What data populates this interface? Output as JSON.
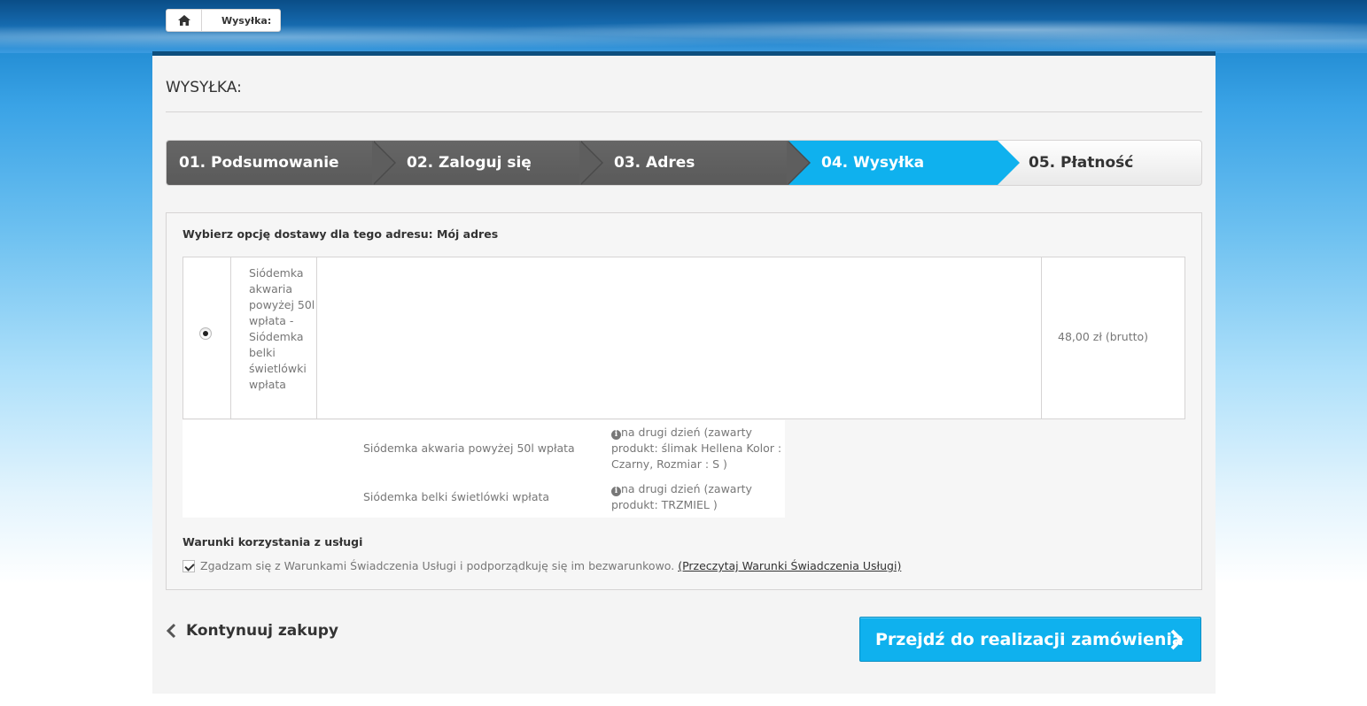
{
  "breadcrumb": {
    "home_icon": "home-icon",
    "current": "Wysyłka:"
  },
  "page": {
    "heading": "WYSYŁKA:"
  },
  "steps": [
    {
      "label": "01. Podsumowanie",
      "state": "done"
    },
    {
      "label": "02. Zaloguj się",
      "state": "done"
    },
    {
      "label": "03. Adres",
      "state": "done"
    },
    {
      "label": "04. Wysyłka",
      "state": "active"
    },
    {
      "label": "05. Płatność",
      "state": "todo"
    }
  ],
  "delivery": {
    "title": "Wybierz opcję dostawy dla tego adresu: Mój adres",
    "carrier": {
      "selected": true,
      "name": "Siódemka akwaria powyżej 50l wpłata - Siódemka belki świetlówki wpłata",
      "price": "48,00 zł (brutto)"
    },
    "details": [
      {
        "name": "Siódemka akwaria powyżej 50l wpłata",
        "info": "na drugi dzień (zawarty produkt: ślimak Hellena Kolor : Czarny, Rozmiar : S )"
      },
      {
        "name": "Siódemka belki świetlówki wpłata",
        "info": "na drugi dzień (zawarty produkt: TRZMIEL )"
      }
    ]
  },
  "terms": {
    "title": "Warunki korzystania z usługi",
    "checked": true,
    "text": "Zgadzam się z Warunkami Świadczenia Usługi i podporządkuję się im bezwarunkowo.",
    "link": "(Przeczytaj Warunki Świadczenia Usługi)"
  },
  "actions": {
    "continue_label": "Kontynuuj zakupy",
    "proceed_label": "Przejdź do realizacji zamówienia"
  },
  "colors": {
    "accent": "#0fb1ee",
    "step_done": "#5e5e5e",
    "header_bar": "#0e4f7e"
  }
}
